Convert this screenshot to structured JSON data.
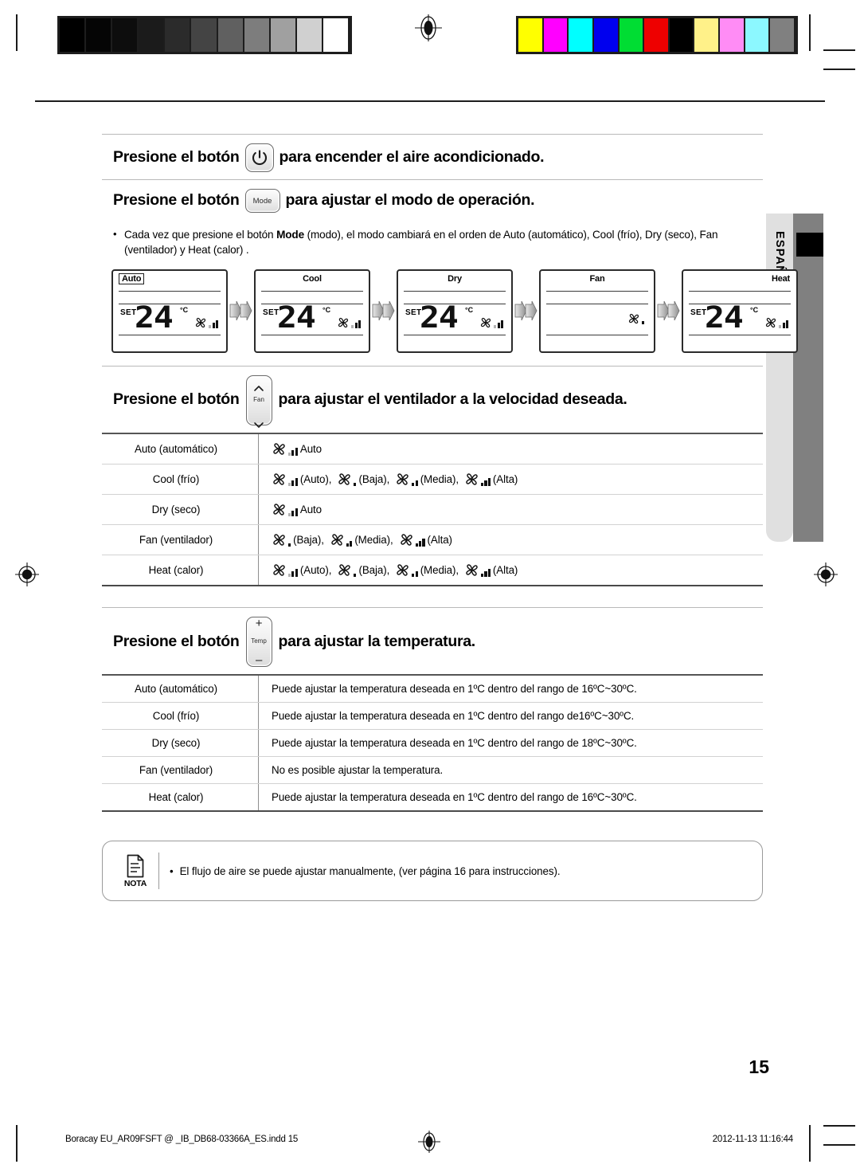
{
  "document": {
    "page_number": "15",
    "language_tab": "ESPAÑOL",
    "footer_file": "Boracay EU_AR09FSFT @ _IB_DB68-03366A_ES.indd   15",
    "footer_timestamp": "2012-11-13   11:16:44"
  },
  "calibration": {
    "gray_bar": [
      "#000000",
      "#050505",
      "#0d0d0d",
      "#1b1b1b",
      "#2b2b2b",
      "#444444",
      "#606060",
      "#7d7d7d",
      "#a0a0a0",
      "#d0d0d0",
      "#ffffff"
    ],
    "color_bar": [
      "#ffff00",
      "#ff00ff",
      "#00ffff",
      "#0000ee",
      "#00dd33",
      "#ee0000",
      "#000000",
      "#fff189",
      "#ff8cf5",
      "#8cf8ff",
      "#808080"
    ]
  },
  "sections": {
    "power": {
      "text_before": "Presione el botón",
      "button": "power-button",
      "text_after": "para encender el aire acondicionado."
    },
    "mode": {
      "text_before": "Presione el botón",
      "button_label": "Mode",
      "text_after": "para ajustar el modo de operación.",
      "bullet_dot": "•",
      "bullet_pre": "Cada vez que presione el botón ",
      "bullet_bold": "Mode",
      "bullet_post": "  (modo), el modo cambiará en el orden de Auto (automático), Cool (frío), Dry (seco), Fan (ventilador) y Heat (calor) ."
    },
    "fan": {
      "text_before": "Presione el botón",
      "button_label": "Fan",
      "text_after": "para ajustar el ventilador a la velocidad deseada."
    },
    "temp": {
      "text_before": "Presione el botón",
      "button_label": "Temp",
      "button_plus": "+",
      "button_minus": "–",
      "text_after": "para ajustar la temperatura."
    }
  },
  "lcd_panels": [
    {
      "mode": "Auto",
      "boxed": true,
      "align": "left",
      "set_label": "SET",
      "temperature": "24",
      "unit": "°C",
      "show_temp": true,
      "fan": "auto"
    },
    {
      "mode": "Cool",
      "boxed": false,
      "align": "center",
      "set_label": "SET",
      "temperature": "24",
      "unit": "°C",
      "show_temp": true,
      "fan": "auto"
    },
    {
      "mode": "Dry",
      "boxed": false,
      "align": "center",
      "set_label": "SET",
      "temperature": "24",
      "unit": "°C",
      "show_temp": true,
      "fan": "auto"
    },
    {
      "mode": "Fan",
      "boxed": false,
      "align": "center",
      "set_label": "",
      "temperature": "",
      "unit": "",
      "show_temp": false,
      "fan": "low"
    },
    {
      "mode": "Heat",
      "boxed": false,
      "align": "right",
      "set_label": "SET",
      "temperature": "24",
      "unit": "°C",
      "show_temp": true,
      "fan": "auto"
    }
  ],
  "fan_table": {
    "rows": [
      {
        "mode": "Auto (automático)",
        "speeds": [
          {
            "icon": "auto",
            "label": "Auto"
          }
        ]
      },
      {
        "mode": "Cool (frío)",
        "speeds": [
          {
            "icon": "auto",
            "label": "(Auto),"
          },
          {
            "icon": "low",
            "label": "(Baja),"
          },
          {
            "icon": "med",
            "label": "(Media),"
          },
          {
            "icon": "high",
            "label": "(Alta)"
          }
        ]
      },
      {
        "mode": "Dry (seco)",
        "speeds": [
          {
            "icon": "auto",
            "label": "Auto"
          }
        ]
      },
      {
        "mode": "Fan (ventilador)",
        "speeds": [
          {
            "icon": "low",
            "label": "(Baja),"
          },
          {
            "icon": "med",
            "label": "(Media),"
          },
          {
            "icon": "high",
            "label": "(Alta)"
          }
        ]
      },
      {
        "mode": "Heat (calor)",
        "speeds": [
          {
            "icon": "auto",
            "label": "(Auto),"
          },
          {
            "icon": "low",
            "label": "(Baja),"
          },
          {
            "icon": "med",
            "label": "(Media),"
          },
          {
            "icon": "high",
            "label": "(Alta)"
          }
        ]
      }
    ]
  },
  "temp_table": {
    "rows": [
      {
        "mode": "Auto (automático)",
        "desc": "Puede ajustar la temperatura deseada en 1ºC dentro del rango de 16ºC~30ºC."
      },
      {
        "mode": "Cool (frío)",
        "desc": "Puede ajustar la temperatura deseada en 1ºC dentro del rango de16ºC~30ºC."
      },
      {
        "mode": "Dry (seco)",
        "desc": "Puede ajustar la temperatura deseada en 1ºC dentro del rango de 18ºC~30ºC."
      },
      {
        "mode": "Fan (ventilador)",
        "desc": "No es posible ajustar la temperatura."
      },
      {
        "mode": "Heat (calor)",
        "desc": "Puede ajustar la temperatura deseada en 1ºC dentro del rango de 16ºC~30ºC."
      }
    ]
  },
  "note": {
    "badge": "NOTA",
    "bullet_dot": "•",
    "text": "El flujo de aire se puede ajustar manualmente, (ver página 16 para instrucciones)."
  }
}
